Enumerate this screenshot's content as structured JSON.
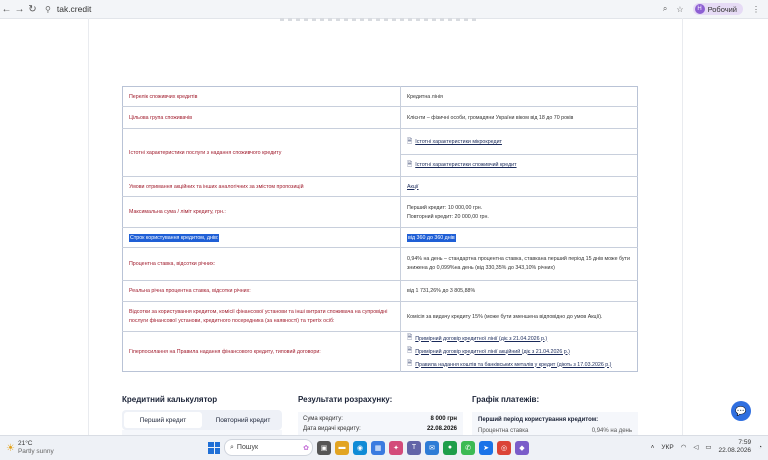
{
  "browser": {
    "url": "tak.credit",
    "profile_initial": "Н",
    "profile_name": "Робочий"
  },
  "info_table": {
    "list_label": "Перелік споживчих кредитів",
    "list_value": "Кредитна лінія",
    "target_label": "Цільова група споживачів",
    "target_value": "Клієнти – фізичні особи, громадяни України віком від 18 до 70 років",
    "chars_label": "Істотні характеристики послуги з надання споживчого кредиту",
    "chars_link_1": "Істотні характеристики мікрокредит",
    "chars_link_2": "Істотні характеристики споживчий кредит",
    "promo_label": "Умови отримання акційних та інших аналогічних за змістом пропозицій",
    "promo_value": "Акції",
    "max_label": "Максимальна сума / ліміт кредиту, грн.:",
    "max_value_1": "Перший кредит: 10 000,00 грн.",
    "max_value_2": "Повторний кредит: 20 000,00 грн.",
    "term_label": "Строк користування кредитом, днів:",
    "term_value": "від 360 до 360 днів",
    "rate_label": "Процентна ставка, відсотки річних:",
    "rate_value": "0,94% на день – стандартна процентна ставка, ставкана перший період 15 днів може бути знижена до 0,099%на день (від 330,35% до 343,10% річних)",
    "real_label": "Реальна річна процентна ставка, відсотки річних:",
    "real_value": "від 1 731,26% до 3 805,88%",
    "fees_label": "Відсотки за користування кредитом, комісії фінансової установи та інші витрати споживача на супровідні послуги фінансової установи, кредитного посередника (за наявності) та третіх осіб:",
    "fees_value": "Комісія за видачу кредиту 15% (може бути зменшена відповідно до умов Акції).",
    "hyper_label": "Гіперпосилання на Правила надання фінансового кредиту, типовий договори:",
    "hyper_link_1": "Примірний договір кредитної лінії (діє з 21.04.2026 р.)",
    "hyper_link_2": "Примірний договір кредитної лінії акційний (діє з 21.04.2026 р.)",
    "hyper_link_3": "Правила надання коштів та банківських металів у кредит (діють з 17.03.2026 р.)"
  },
  "calculator": {
    "title": "Кредитний калькулятор",
    "tab_first": "Перший кредит",
    "tab_repeat": "Повторний кредит"
  },
  "results": {
    "title": "Результати розрахунку:",
    "sum_label": "Сума кредиту:",
    "sum_value": "8 000 грн",
    "date_label": "Дата видачі кредиту:",
    "date_value": "22.08.2026"
  },
  "schedule": {
    "title": "Графік платежів:",
    "period_title": "Перший період користування кредитом:",
    "rate_label": "Процентна ставка",
    "rate_value": "0,94% на день"
  },
  "taskbar": {
    "temperature": "21°C",
    "weather": "Partly sunny",
    "search_placeholder": "Пошук",
    "language": "УКР",
    "time": "7:59",
    "date": "22.08.2026"
  },
  "colors": {
    "accent": "#1f5fd6",
    "label_red": "#a01b2c",
    "link_navy": "#1a2a5a"
  }
}
